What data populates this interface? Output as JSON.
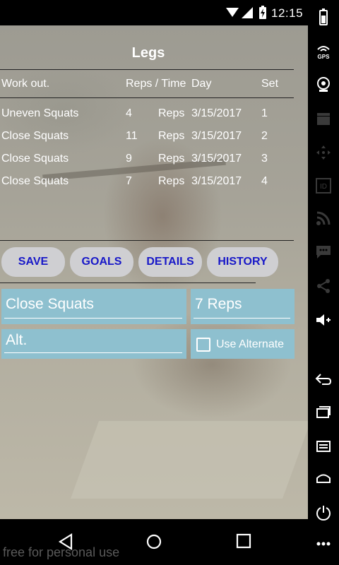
{
  "status_bar": {
    "time": "12:15"
  },
  "screen": {
    "title": "Legs"
  },
  "table": {
    "headers": {
      "workout": "Work out.",
      "reps_time": "Reps / Time",
      "day": "Day",
      "set": "Set"
    },
    "rows": [
      {
        "workout": "Uneven Squats",
        "count": "4",
        "unit": "Reps",
        "day": "3/15/2017",
        "set": "1"
      },
      {
        "workout": "Close Squats",
        "count": "11",
        "unit": "Reps",
        "day": "3/15/2017",
        "set": "2"
      },
      {
        "workout": "Close Squats",
        "count": "9",
        "unit": "Reps",
        "day": "3/15/2017",
        "set": "3"
      },
      {
        "workout": "Close Squats",
        "count": "7",
        "unit": "Reps",
        "day": "3/15/2017",
        "set": "4"
      }
    ]
  },
  "buttons": {
    "save": "SAVE",
    "goals": "GOALS",
    "details": "DETAILS",
    "history": "HISTORY"
  },
  "form": {
    "exercise_value": "Close Squats",
    "reps_value": "7 Reps",
    "alt_value": "Alt.",
    "use_alternate_label": "Use Alternate",
    "use_alternate_checked": false
  },
  "side_nav": {
    "gps_label": "GPS",
    "id_label": "ID",
    "icons": [
      "battery-icon",
      "gps-icon",
      "webcam-icon",
      "clapperboard-icon",
      "dpad-icon",
      "id-icon",
      "rss-icon",
      "sms-icon",
      "share-icon",
      "volume-up-icon",
      "back-icon",
      "recents-icon",
      "menu-icon",
      "home-icon",
      "power-icon",
      "more-icon"
    ]
  },
  "bottom_nav": {
    "icons": [
      "back-triangle-icon",
      "home-circle-icon",
      "recents-square-icon"
    ]
  },
  "watermark": "free for personal use",
  "colors": {
    "button_text": "#1818c8",
    "button_bg": "#cfcfd2",
    "field_bg": "#8ec0cf"
  }
}
